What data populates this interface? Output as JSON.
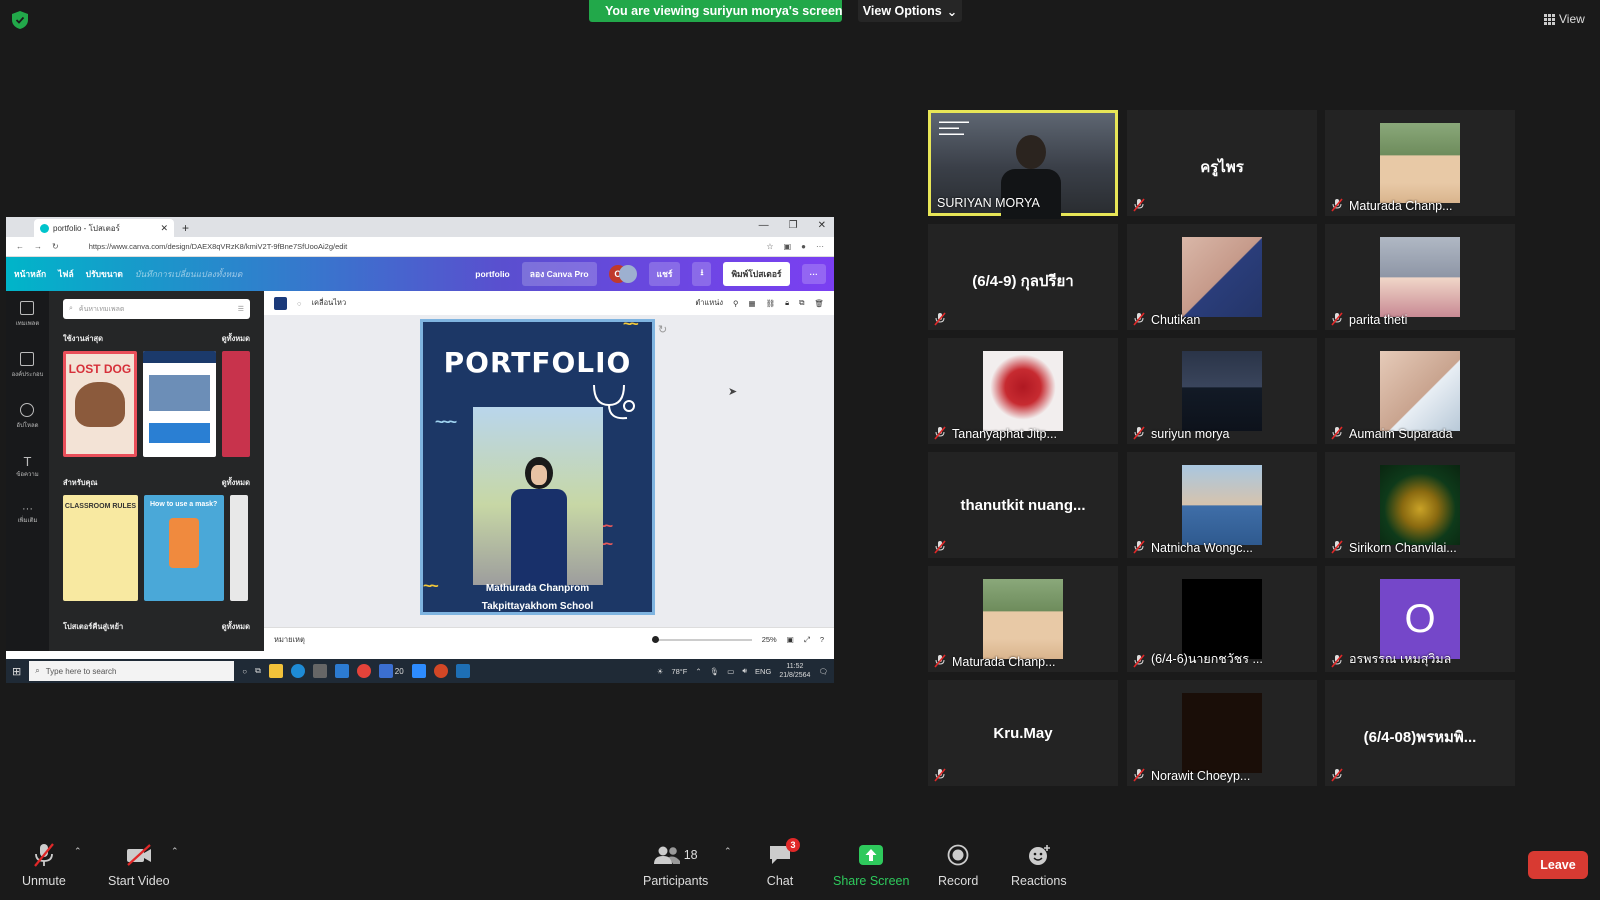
{
  "top": {
    "share_banner": "You are viewing suriyun morya's screen",
    "view_options": "View Options",
    "view_label": "View"
  },
  "shared_screen": {
    "tab_title": "portfolio - โปสเตอร์",
    "url": "https://www.canva.com/design/DAEX8qVRzK8/kmiV2T-9fBne7SfUooAi2g/edit",
    "canva_nav": [
      "หน้าหลัก",
      "ไฟล์",
      "ปรับขนาด"
    ],
    "canva_saved": "บันทึกการเปลี่ยนแปลงทั้งหมด",
    "canva_title": "portfolio",
    "canva_pro": "ลอง Canva Pro",
    "avatar_letter": "C",
    "share": "แชร์",
    "print": "พิมพ์โปสเตอร์",
    "rail": [
      "เทมเพลต",
      "องค์ประกอบ",
      "อัปโหลด",
      "ข้อความ",
      "เพิ่มเติม"
    ],
    "search_placeholder": "ค้นหาเทมเพลต",
    "sections": [
      {
        "title": "ใช้งานล่าสุด",
        "see_all": "ดูทั้งหมด"
      },
      {
        "title": "สำหรับคุณ",
        "see_all": "ดูทั้งหมด"
      },
      {
        "title": "โปสเตอร์คืนสู่เหย้า",
        "see_all": "ดูทั้งหมด"
      }
    ],
    "thumb_lost_dog": "LOST DOG",
    "thumb_classroom": "CLASSROOM RULES",
    "thumb_mask": "How to use a mask?",
    "toolbar_animate": "เคลื่อนไหว",
    "toolbar_position": "ตำแหน่ง",
    "poster_title": "PORTFOLIO",
    "poster_name": "Mathurada  Chanprom",
    "poster_school": "Takpittayakhom School",
    "notes": "หมายเหตุ",
    "zoom": "25%",
    "zoom_fraction": 0.0,
    "taskbar_search": "Type here to search",
    "taskbar_badge": "20",
    "weather": "78°F",
    "lang": "ENG",
    "time": "11:52",
    "date": "21/8/2564"
  },
  "gallery": [
    {
      "name": "SURIYAN MORYA",
      "kind": "video",
      "active": true
    },
    {
      "name": "ครูไพร",
      "kind": "name"
    },
    {
      "name": "Maturada Chanp...",
      "kind": "pic",
      "pic": "anime"
    },
    {
      "name": "(6/4-9) กุลปรียา",
      "kind": "name"
    },
    {
      "name": "Chutikan",
      "kind": "pic",
      "pic": "girls"
    },
    {
      "name": "parita theti",
      "kind": "pic",
      "pic": "selfie"
    },
    {
      "name": "Tananyaphat Jitp...",
      "kind": "pic",
      "pic": "hand"
    },
    {
      "name": "suriyun morya",
      "kind": "pic",
      "pic": "man"
    },
    {
      "name": "Aumaim Suparada",
      "kind": "pic",
      "pic": "girls2"
    },
    {
      "name": "thanutkit  nuang...",
      "kind": "name"
    },
    {
      "name": "Natnicha Wongc...",
      "kind": "pic",
      "pic": "outdoor"
    },
    {
      "name": "Sirikorn Chanvilai...",
      "kind": "pic",
      "pic": "loki"
    },
    {
      "name": "Maturada Chanp...",
      "kind": "pic",
      "pic": "anime"
    },
    {
      "name": "(6/4-6)นายกชวัชร ...",
      "kind": "pic",
      "pic": "black"
    },
    {
      "name": "อรพรรณ เหมสุวิมล",
      "kind": "pic",
      "pic": "letter",
      "letter": "O"
    },
    {
      "name": "Kru.May",
      "kind": "name"
    },
    {
      "name": "Norawit Choeyp...",
      "kind": "pic",
      "pic": "dark"
    },
    {
      "name": "(6/4-08)พรหมพิ...",
      "kind": "name"
    }
  ],
  "toolbar": {
    "unmute": "Unmute",
    "start_video": "Start Video",
    "participants": "Participants",
    "participants_count": "18",
    "chat": "Chat",
    "chat_badge": "3",
    "share_screen": "Share Screen",
    "record": "Record",
    "reactions": "Reactions",
    "leave": "Leave"
  },
  "colors": {
    "share_green": "#22a84a",
    "active_border": "#e8e657",
    "leave_red": "#d83a32",
    "poster_blue": "#1c3766"
  }
}
